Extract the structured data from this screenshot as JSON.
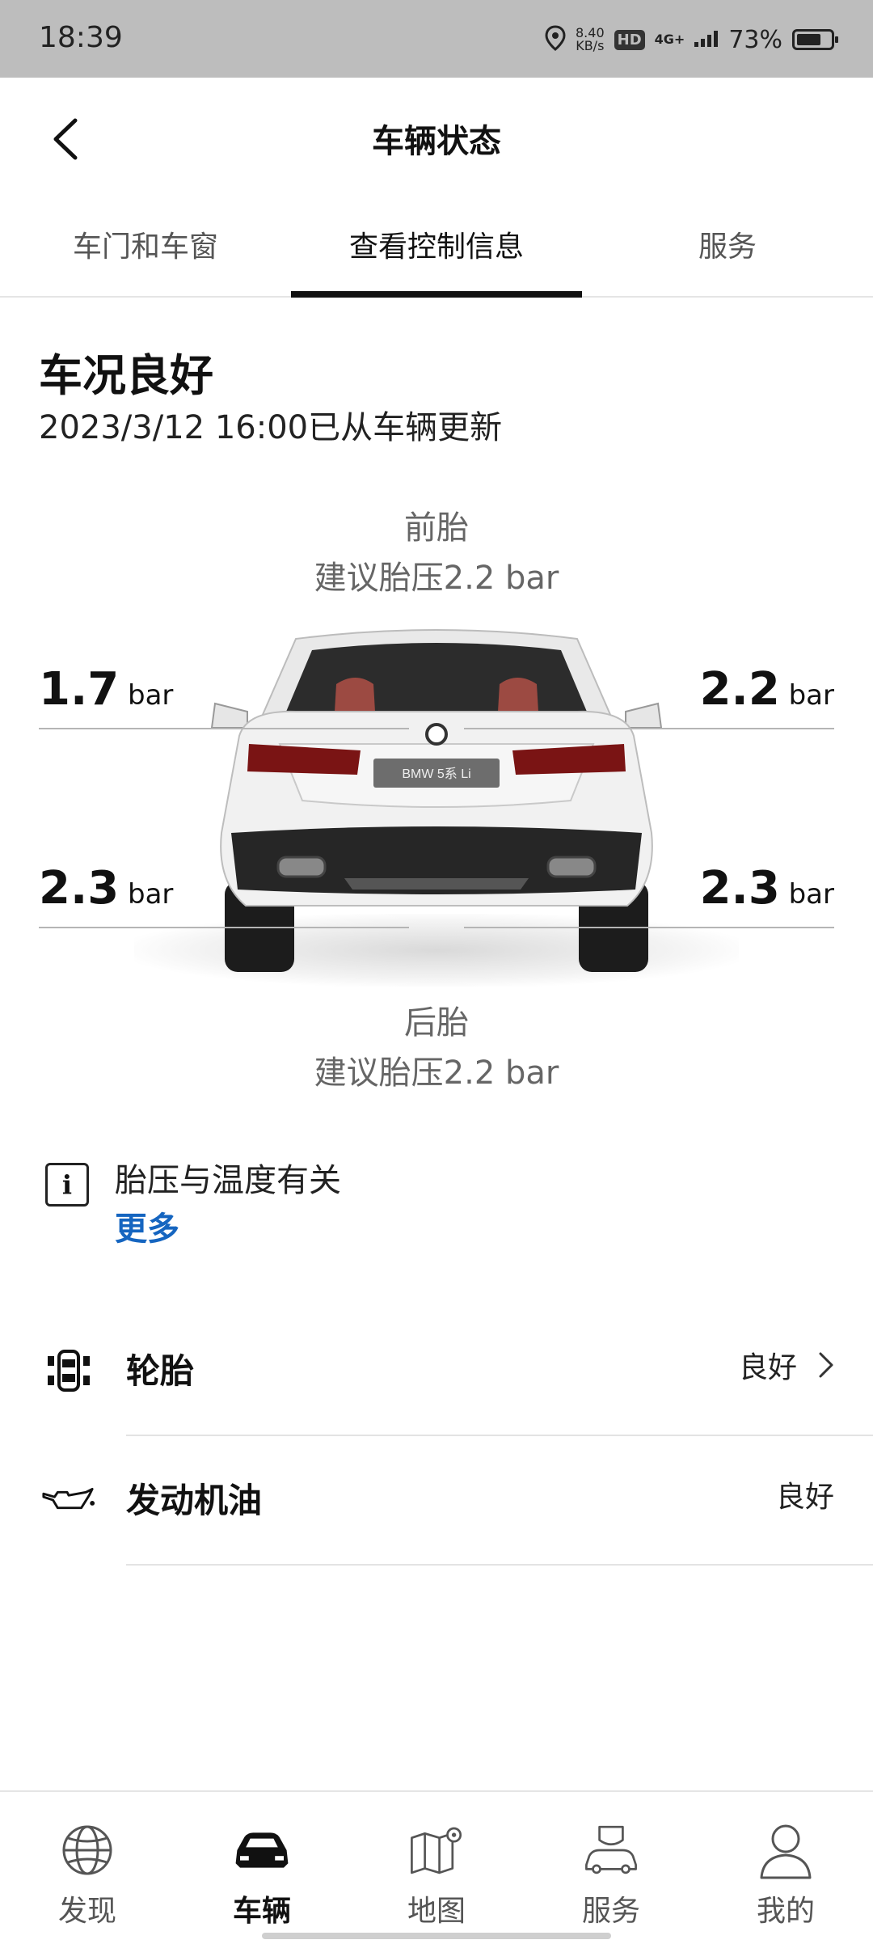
{
  "status_bar": {
    "time": "18:39",
    "speed_value": "8.40",
    "speed_unit": "KB/s",
    "hd": "HD",
    "network": "4G+",
    "battery_percent": "73%",
    "battery_level": 0.73,
    "icons": [
      "location-icon",
      "signal-icon",
      "battery-icon"
    ]
  },
  "header": {
    "title": "车辆状态",
    "back_icon": "chevron-left-icon"
  },
  "tabs": [
    {
      "label": "车门和车窗",
      "active": false
    },
    {
      "label": "查看控制信息",
      "active": true
    },
    {
      "label": "服务",
      "active": false
    }
  ],
  "status": {
    "title": "车况良好",
    "updated": "2023/3/12 16:00已从车辆更新"
  },
  "front": {
    "label": "前胎",
    "recommended": "建议胎压2.2 bar"
  },
  "rear": {
    "label": "后胎",
    "recommended": "建议胎压2.2 bar"
  },
  "tires": {
    "unit": "bar",
    "front_left": "1.7",
    "front_right": "2.2",
    "rear_left": "2.3",
    "rear_right": "2.3"
  },
  "car_badge": "BMW 5系 Li",
  "info": {
    "text": "胎压与温度有关",
    "more": "更多",
    "icon": "info-icon"
  },
  "list": [
    {
      "title": "轮胎",
      "value": "良好",
      "icon": "tire-status-icon",
      "chevron": true
    },
    {
      "title": "发动机油",
      "value": "良好",
      "icon": "oil-can-icon",
      "chevron": false
    }
  ],
  "nav": [
    {
      "label": "发现",
      "icon": "globe-icon",
      "active": false
    },
    {
      "label": "车辆",
      "icon": "car-icon",
      "active": true
    },
    {
      "label": "地图",
      "icon": "map-icon",
      "active": false
    },
    {
      "label": "服务",
      "icon": "service-car-icon",
      "active": false
    },
    {
      "label": "我的",
      "icon": "person-icon",
      "active": false
    }
  ]
}
